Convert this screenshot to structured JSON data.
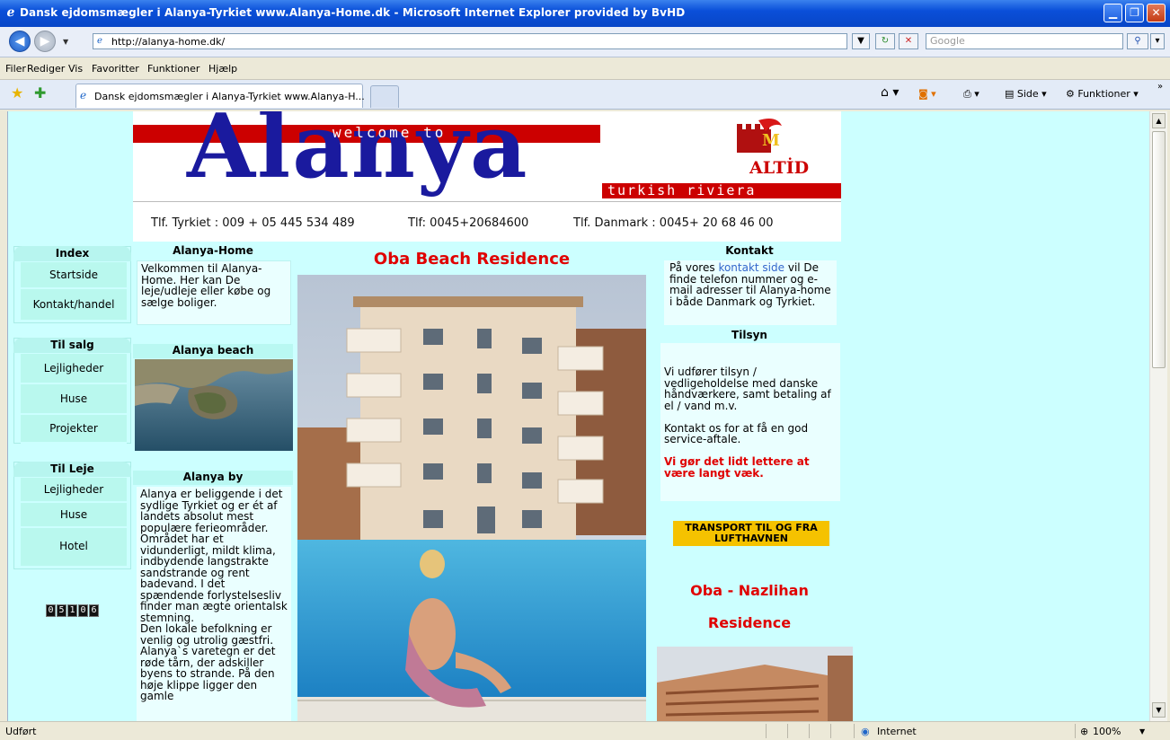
{
  "window": {
    "title": "Dansk ejdomsmægler i Alanya-Tyrkiet www.Alanya-Home.dk - Microsoft Internet Explorer provided by BvHD"
  },
  "address": {
    "url": "http://alanya-home.dk/",
    "search_placeholder": "Google"
  },
  "menu": [
    "Filer",
    "Rediger",
    "Vis",
    "Favoritter",
    "Funktioner",
    "Hjælp"
  ],
  "tab": {
    "label": "Dansk ejdomsmægler i Alanya-Tyrkiet www.Alanya-H..."
  },
  "commandbar": {
    "side": "Side",
    "funktioner": "Funktioner"
  },
  "status": {
    "text": "Udført",
    "zone": "Internet",
    "zoom": "100%"
  },
  "banner": {
    "welcome": "welcome to",
    "alanya": "Alanya",
    "altid": "ALTİD",
    "riviera": "turkish riviera",
    "phone_tr": "Tlf. Tyrkiet : 009 + 05 445 534 489",
    "phone_fax": "Tlf: 0045+20684600",
    "phone_dk": "Tlf. Danmark : 0045+ 20 68 46 00"
  },
  "left_nav": {
    "index_title": "Index",
    "index_items": [
      "Startside",
      "Kontakt/handel"
    ],
    "salg_title": "Til salg",
    "salg_items": [
      "Lejligheder",
      "Huse",
      "Projekter"
    ],
    "leje_title": "Til Leje",
    "leje_items": [
      "Lejligheder",
      "Huse",
      "Hotel"
    ],
    "counter": "05106"
  },
  "col2": {
    "home_title": "Alanya-Home",
    "home_text": "Velkommen til Alanya-Home. Her kan De leje/udleje eller købe og sælge boliger.",
    "beach_title": "Alanya beach",
    "by_title": "Alanya by",
    "by_text_1": "Alanya er beliggende i det sydlige Tyrkiet og er ét af landets absolut mest populære ferieområder. Området har et vidunderligt, mildt klima, indbydende langstrakte sandstrande og rent badevand. I det spændende forlystelsesliv finder man ægte orientalsk stemning.",
    "by_text_2": "Den lokale befolkning er venlig og utrolig gæstfri. Alanya`s varetegn er det røde tårn, der adskiller byens to strande. På den høje klippe ligger den gamle"
  },
  "center": {
    "title": "Oba Beach Residence"
  },
  "right": {
    "kontakt_title": "Kontakt",
    "kontakt_pre": "På vores ",
    "kontakt_link": "kontakt side",
    "kontakt_post": " vil De finde telefon nummer og e-mail adresser til Alanya-home i både Danmark og Tyrkiet.",
    "tilsyn_title": "Tilsyn",
    "tilsyn_text_1": "Vi udfører tilsyn / vedligeholdelse med danske håndværkere, samt betaling af el / vand m.v.",
    "tilsyn_text_2": "Kontakt os for at få en god service-aftale.",
    "tilsyn_red": "Vi gør det lidt lettere at være langt væk.",
    "transport": "TRANSPORT TIL OG FRA LUFTHAVNEN",
    "nazlihan_1": "Oba - Nazlihan",
    "nazlihan_2": "Residence"
  }
}
